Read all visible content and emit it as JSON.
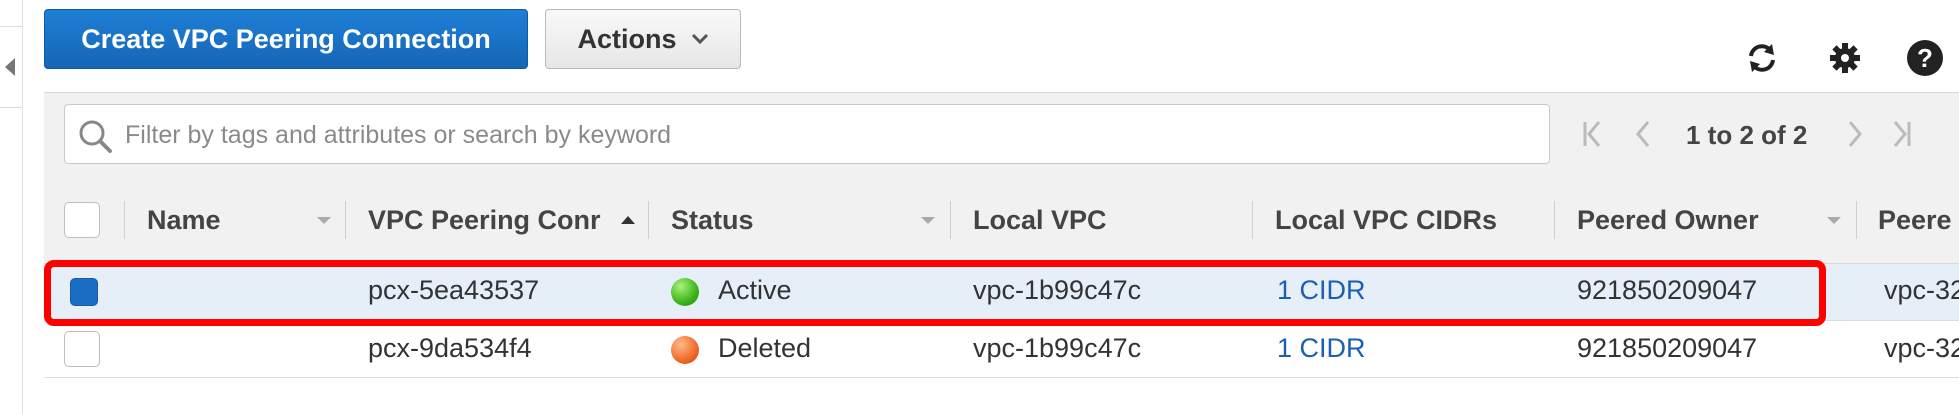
{
  "toolbar": {
    "create_label": "Create VPC Peering Connection",
    "actions_label": "Actions",
    "icons": [
      "refresh-icon",
      "gear-icon",
      "help-icon"
    ]
  },
  "search": {
    "placeholder": "Filter by tags and attributes or search by keyword",
    "value": ""
  },
  "pagination": {
    "text": "1 to 2 of 2"
  },
  "table": {
    "columns": [
      "Name",
      "VPC Peering Conr",
      "Status",
      "Local VPC",
      "Local VPC CIDRs",
      "Peered Owner",
      "Peere"
    ],
    "sorted_column": "VPC Peering Conr",
    "rows": [
      {
        "selected": true,
        "name": "",
        "peering_id": "pcx-5ea43537",
        "status": "Active",
        "status_color": "#3bb41a",
        "local_vpc": "vpc-1b99c47c",
        "local_cidrs": "1 CIDR",
        "peered_owner": "921850209047",
        "peered_vpc": "vpc-32"
      },
      {
        "selected": false,
        "name": "",
        "peering_id": "pcx-9da534f4",
        "status": "Deleted",
        "status_color": "#f06a2a",
        "local_vpc": "vpc-1b99c47c",
        "local_cidrs": "1 CIDR",
        "peered_owner": "921850209047",
        "peered_vpc": "vpc-32"
      }
    ]
  },
  "colors": {
    "primary": "#1a6cc4",
    "link": "#1a5fb4",
    "highlight": "#ff0000"
  }
}
